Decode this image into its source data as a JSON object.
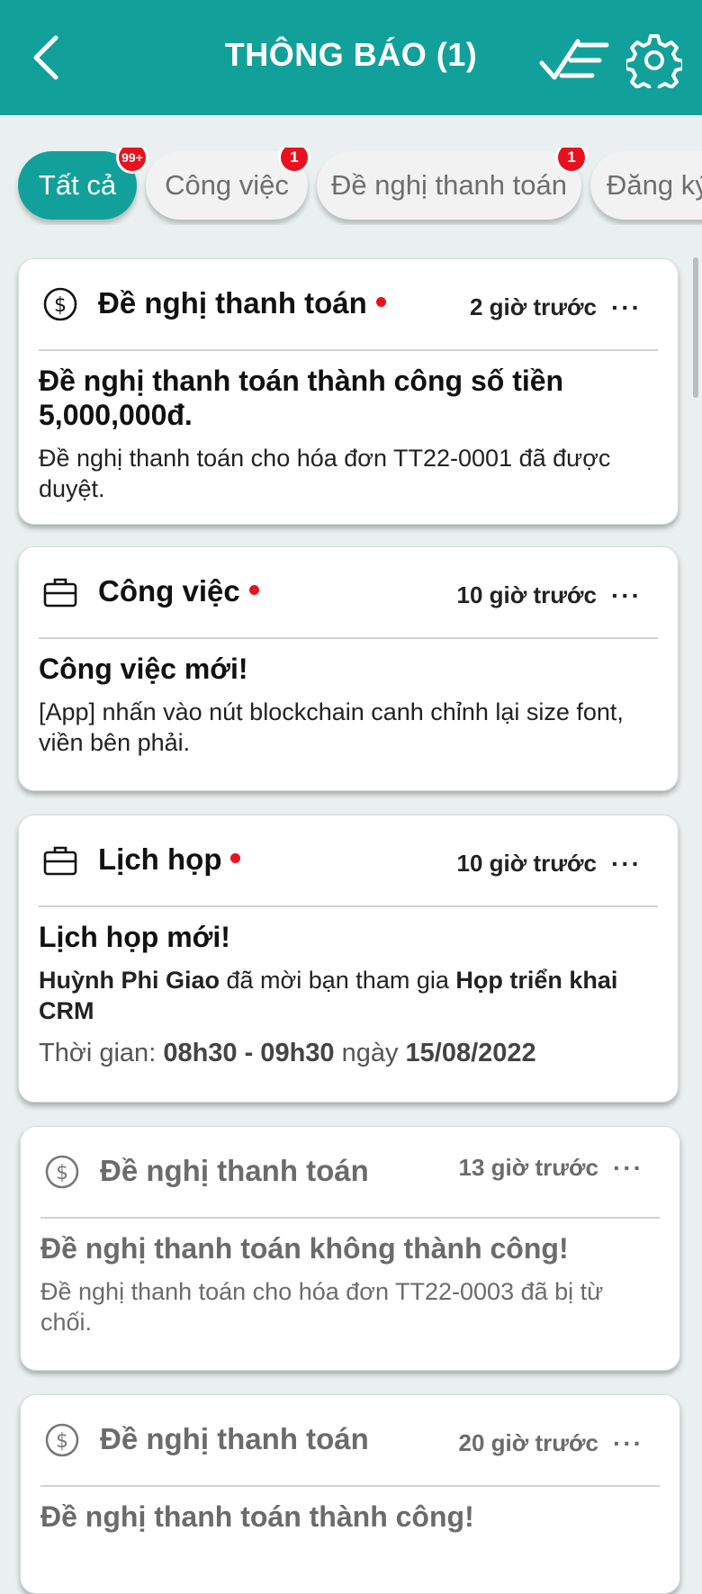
{
  "header": {
    "title": "THÔNG BÁO (1)"
  },
  "tabs": [
    {
      "label": "Tất cả",
      "badge": "99+"
    },
    {
      "label": "Công việc",
      "badge": "1"
    },
    {
      "label": "Đề nghị thanh toán",
      "badge": "1"
    },
    {
      "label": "Đăng ký",
      "badge": ""
    }
  ],
  "colors": {
    "primary": "#12a19a",
    "badge": "#e8121e"
  },
  "notifications": [
    {
      "icon": "dollar-circle-icon",
      "category": "Đề nghị thanh toán",
      "unread": true,
      "time": "2 giờ trước",
      "title": "Đề nghị thanh toán thành công số tiền 5,000,000đ.",
      "desc": "Đề nghị thanh toán cho hóa đơn TT22-0001 đã được duyệt."
    },
    {
      "icon": "briefcase-icon",
      "category": "Công việc",
      "unread": true,
      "time": "10 giờ trước",
      "title": "Công việc mới!",
      "desc": "[App] nhấn vào nút blockchain canh chỉnh lại size font, viền bên phải."
    },
    {
      "icon": "briefcase-icon",
      "category": "Lịch họp",
      "unread": true,
      "time": "10 giờ trước",
      "title": "Lịch họp mới!",
      "inviter": "Huỳnh Phi Giao",
      "invite_text": " đã mời bạn tham gia ",
      "meeting": "Họp triển khai CRM",
      "time_label": "Thời gian: ",
      "time_range": "08h30 - 09h30",
      "date_label": " ngày ",
      "date": "15/08/2022"
    },
    {
      "icon": "dollar-circle-icon",
      "category": "Đề nghị thanh toán",
      "unread": false,
      "time": "13 giờ trước",
      "title": "Đề nghị thanh toán không thành công!",
      "desc": "Đề nghị thanh toán cho hóa đơn TT22-0003 đã bị từ chối."
    },
    {
      "icon": "dollar-circle-icon",
      "category": "Đề nghị thanh toán",
      "unread": false,
      "time": "20 giờ trước",
      "title": "Đề nghị thanh toán thành công!"
    }
  ]
}
